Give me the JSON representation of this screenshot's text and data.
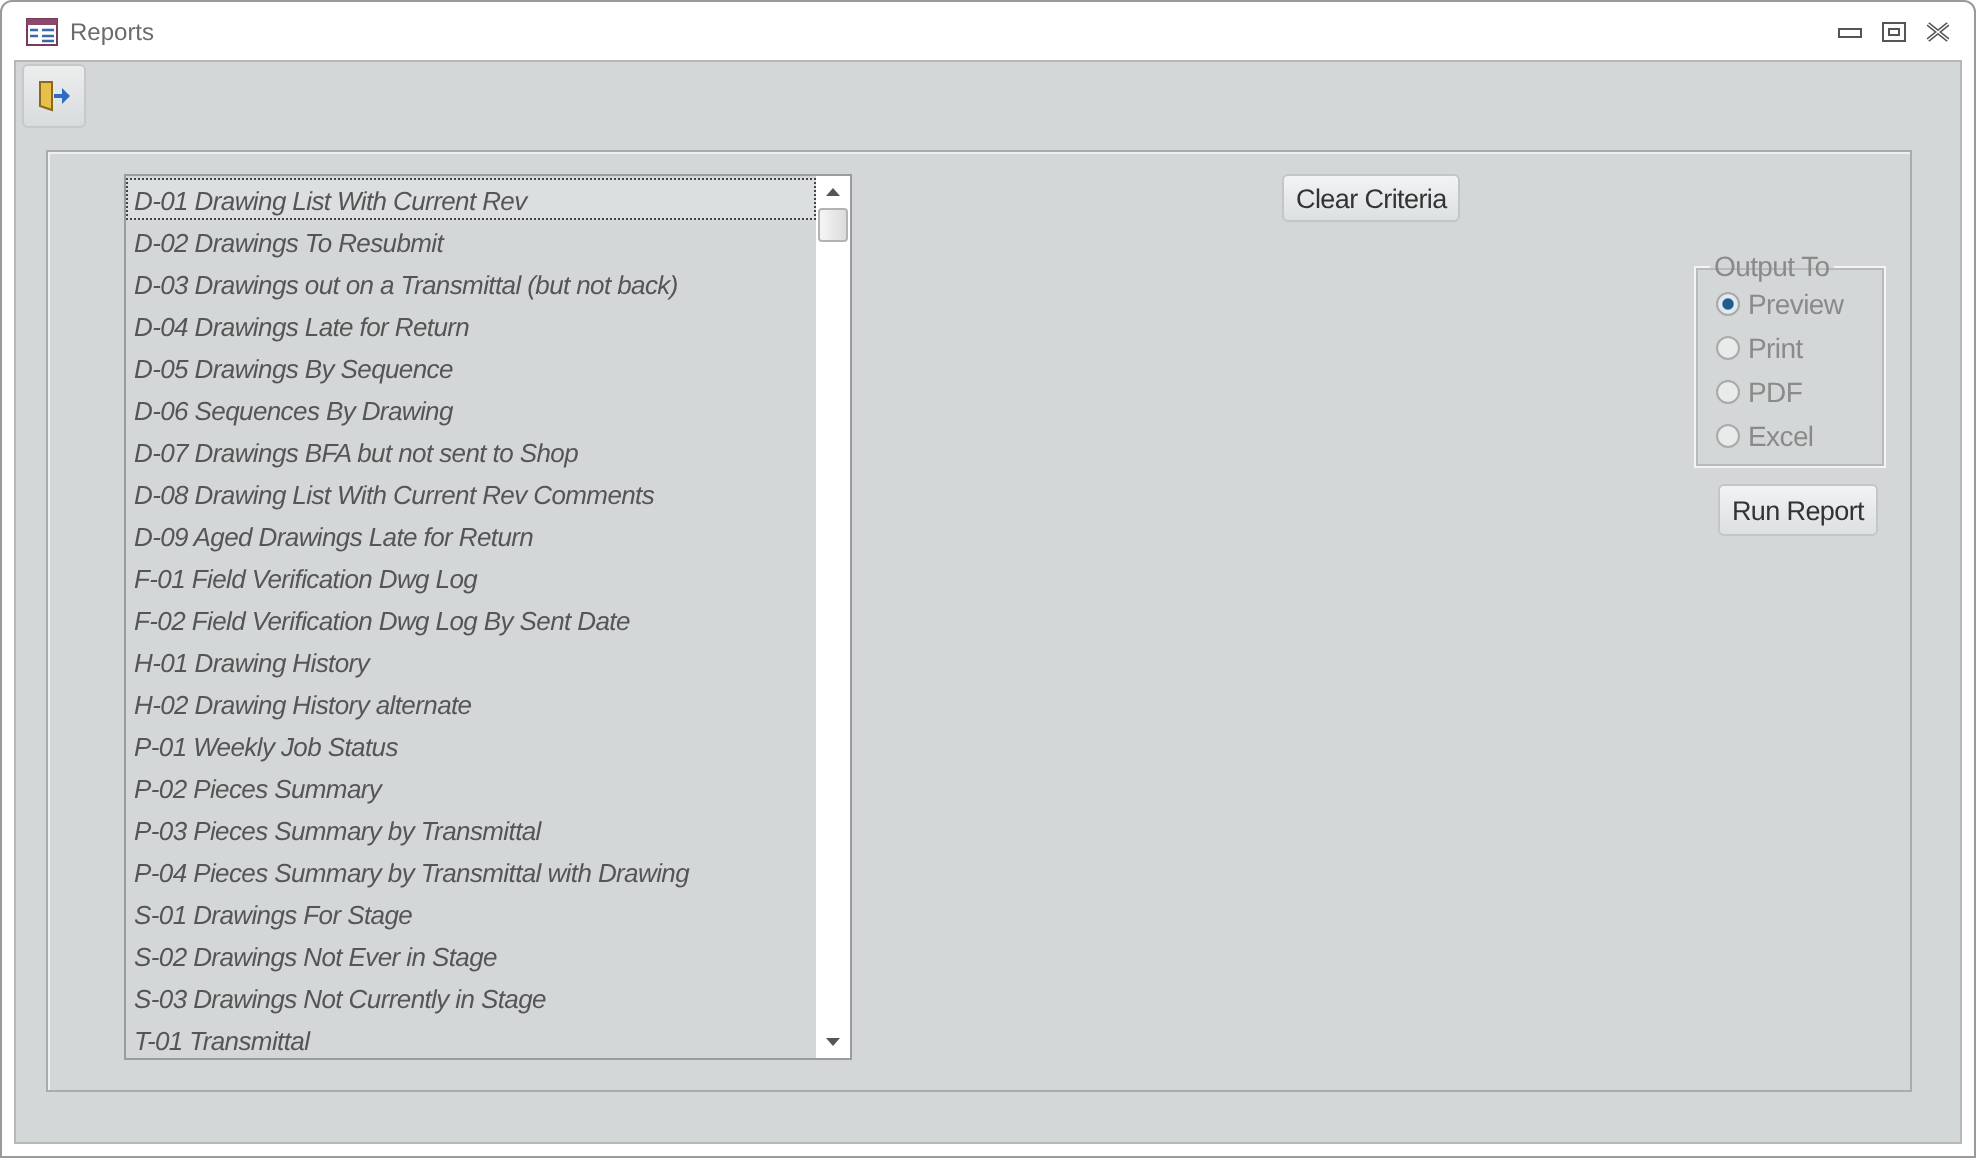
{
  "window": {
    "title": "Reports"
  },
  "reports": [
    {
      "label": "D-01 Drawing List With Current Rev",
      "selected": true
    },
    {
      "label": "D-02 Drawings To Resubmit",
      "selected": false
    },
    {
      "label": "D-03 Drawings out on a Transmittal (but not back)",
      "selected": false
    },
    {
      "label": "D-04 Drawings Late for Return",
      "selected": false
    },
    {
      "label": "D-05 Drawings By Sequence",
      "selected": false
    },
    {
      "label": "D-06 Sequences By Drawing",
      "selected": false
    },
    {
      "label": "D-07 Drawings BFA but not sent to Shop",
      "selected": false
    },
    {
      "label": "D-08 Drawing List With Current Rev Comments",
      "selected": false
    },
    {
      "label": "D-09 Aged Drawings Late for Return",
      "selected": false
    },
    {
      "label": "F-01 Field Verification Dwg Log",
      "selected": false
    },
    {
      "label": "F-02 Field Verification Dwg Log By Sent Date",
      "selected": false
    },
    {
      "label": "H-01 Drawing History",
      "selected": false
    },
    {
      "label": "H-02 Drawing History alternate",
      "selected": false
    },
    {
      "label": "P-01 Weekly Job Status",
      "selected": false
    },
    {
      "label": "P-02 Pieces Summary",
      "selected": false
    },
    {
      "label": "P-03 Pieces Summary by Transmittal",
      "selected": false
    },
    {
      "label": "P-04 Pieces Summary by Transmittal with Drawing",
      "selected": false
    },
    {
      "label": "S-01 Drawings For Stage",
      "selected": false
    },
    {
      "label": "S-02 Drawings Not Ever in Stage",
      "selected": false
    },
    {
      "label": "S-03 Drawings Not Currently in Stage",
      "selected": false
    },
    {
      "label": "T-01 Transmittal",
      "selected": false
    }
  ],
  "clear_button": "Clear Criteria",
  "output_to": {
    "title": "Output To",
    "options": [
      {
        "label": "Preview",
        "selected": true
      },
      {
        "label": "Print",
        "selected": false
      },
      {
        "label": "PDF",
        "selected": false
      },
      {
        "label": "Excel",
        "selected": false
      }
    ]
  },
  "run_button": "Run Report"
}
